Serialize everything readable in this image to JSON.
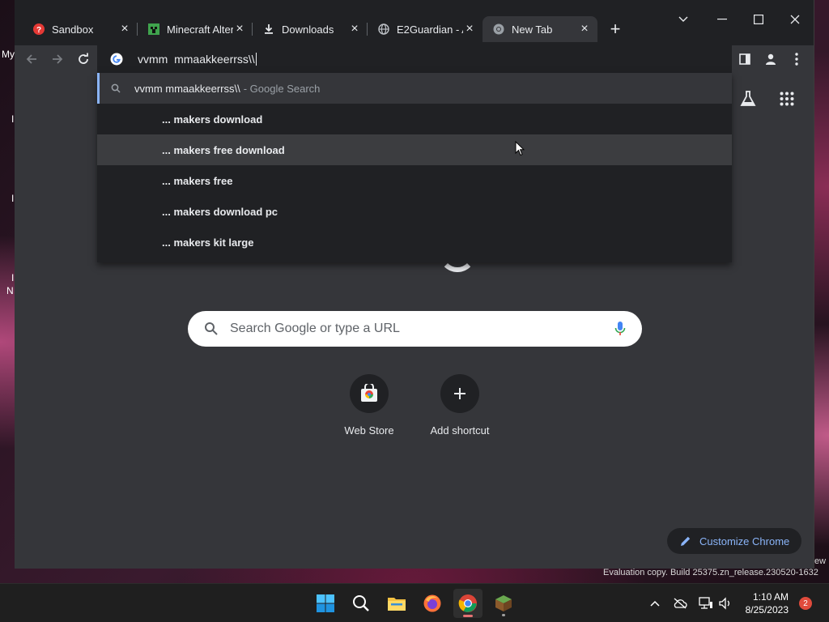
{
  "desktop": {
    "side_labels": [
      "My",
      "I",
      "I",
      "N",
      "I"
    ],
    "watermark": "Evaluation copy. Build 25375.zn_release.230520-1632",
    "watermark_edge": "ew"
  },
  "tabs": [
    {
      "title": "Sandbox",
      "icon": "help-circle-icon",
      "active": false
    },
    {
      "title": "Minecraft Alter",
      "icon": "minecraft-icon",
      "active": false
    },
    {
      "title": "Downloads",
      "icon": "download-icon",
      "active": false
    },
    {
      "title": "E2Guardian - A",
      "icon": "globe-icon",
      "active": false
    },
    {
      "title": "New Tab",
      "icon": "chrome-icon",
      "active": true
    }
  ],
  "omnibox": {
    "value": "vvmm  mmaakkeerrss\\\\"
  },
  "dropdown": {
    "first": {
      "query": "vvmm mmaakkeerrss\\\\",
      "suffix": "- Google Search"
    },
    "suggestions": [
      "... makers download",
      "... makers free download",
      "... makers free",
      "... makers download pc",
      "... makers kit large"
    ]
  },
  "ntp": {
    "search_placeholder": "Search Google or type a URL",
    "shortcuts": [
      {
        "label": "Web Store",
        "icon": "web-store-icon"
      },
      {
        "label": "Add shortcut",
        "icon": "plus-icon"
      }
    ],
    "customize_label": "Customize Chrome"
  },
  "taskbar": {
    "apps": [
      "start-icon",
      "search-icon",
      "file-explorer-icon",
      "firefox-icon",
      "chrome-icon",
      "minecraft-icon"
    ],
    "time": "1:10 AM",
    "date": "8/25/2023",
    "notifications": "2"
  },
  "colors": {
    "accent": "#8ab4f8",
    "tab_bg": "#202124",
    "toolbar_bg": "#35363a"
  }
}
